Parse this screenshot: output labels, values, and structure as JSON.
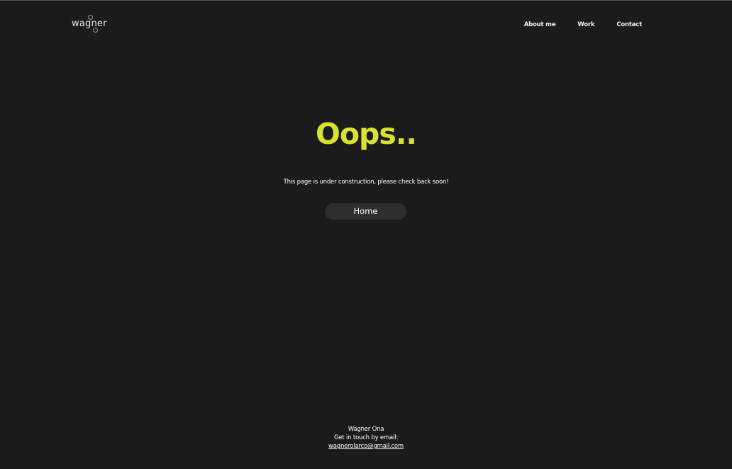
{
  "logo": {
    "text": "wagner"
  },
  "nav": {
    "items": [
      {
        "label": "About me"
      },
      {
        "label": "Work"
      },
      {
        "label": "Contact"
      }
    ]
  },
  "main": {
    "headline": "Oops..",
    "message": "This page is under construction, please check back soon!",
    "home_label": "Home"
  },
  "footer": {
    "name": "Wagner Ona",
    "cta": "Get in touch by email:",
    "email": "wagnerolarco@gmail.com"
  },
  "colors": {
    "background": "#1b1b1b",
    "accent": "#d9e32c",
    "button_bg": "#2e2e2e",
    "text": "#ffffff"
  }
}
